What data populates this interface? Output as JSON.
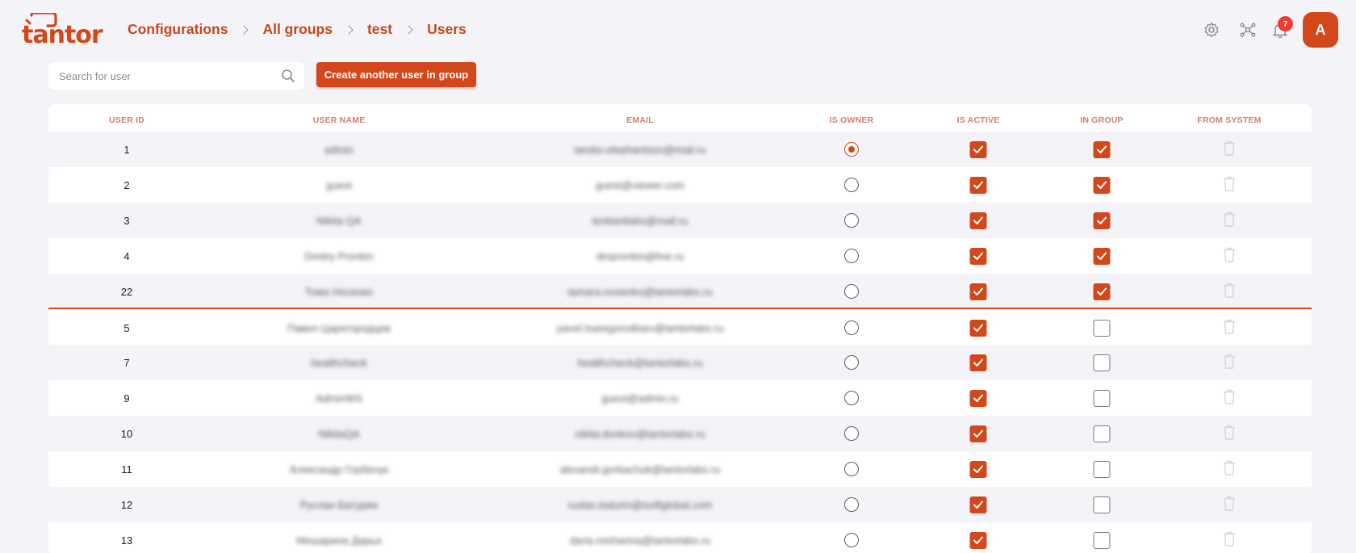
{
  "logo": {
    "text": "tantor"
  },
  "breadcrumb": [
    {
      "label": "Configurations"
    },
    {
      "label": "All groups"
    },
    {
      "label": "test"
    },
    {
      "label": "Users"
    }
  ],
  "header": {
    "notification_count": "7",
    "avatar_initial": "A",
    "icons": [
      "gear-icon",
      "network-icon",
      "bell-icon"
    ]
  },
  "search": {
    "placeholder": "Search for user",
    "value": ""
  },
  "create_button": {
    "label": "Create another user in group"
  },
  "table": {
    "columns": [
      "USER ID",
      "USER NAME",
      "EMAIL",
      "IS OWNER",
      "IS ACTIVE",
      "IN GROUP",
      "FROM SYSTEM"
    ],
    "rows": [
      {
        "id": "1",
        "name": "admin",
        "email": "tandor.elephantson@mail.ru",
        "is_owner": true,
        "is_active": true,
        "in_group": true
      },
      {
        "id": "2",
        "name": "guest",
        "email": "guest@viewer.com",
        "is_owner": false,
        "is_active": true,
        "in_group": true
      },
      {
        "id": "3",
        "name": "Nikita QA",
        "email": "testtantlabs@mail.ru",
        "is_owner": false,
        "is_active": true,
        "in_group": true
      },
      {
        "id": "4",
        "name": "Dmitry Pronkin",
        "email": "dmpronkin@live.ru",
        "is_owner": false,
        "is_active": true,
        "in_group": true
      },
      {
        "id": "22",
        "name": "Тома Носенко",
        "email": "tamara.nosenko@tantorlabs.ru",
        "is_owner": false,
        "is_active": true,
        "in_group": true
      },
      {
        "id": "5",
        "name": "Павел Царегородцев",
        "email": "pavel.tsaregorodtsev@tantorlabs.ru",
        "is_owner": false,
        "is_active": true,
        "in_group": false
      },
      {
        "id": "7",
        "name": "healthcheck",
        "email": "healthcheck@tantorlabs.ru",
        "is_owner": false,
        "is_active": true,
        "in_group": false
      },
      {
        "id": "9",
        "name": "AdminWS",
        "email": "guest@admin.ru",
        "is_owner": false,
        "is_active": true,
        "in_group": false
      },
      {
        "id": "10",
        "name": "NikitaQA",
        "email": "nikita.donkov@tantorlabs.ru",
        "is_owner": false,
        "is_active": true,
        "in_group": false
      },
      {
        "id": "11",
        "name": "Александр Горбачук",
        "email": "alexandr.gorbachuk@tantorlabs.ru",
        "is_owner": false,
        "is_active": true,
        "in_group": false
      },
      {
        "id": "12",
        "name": "Руслан Батурин",
        "email": "ruslan.baturin@isoftglobal.com",
        "is_owner": false,
        "is_active": true,
        "in_group": false
      },
      {
        "id": "13",
        "name": "Мешарина Дарья",
        "email": "daria.misharina@tantorlabs.ru",
        "is_owner": false,
        "is_active": true,
        "in_group": false
      }
    ]
  },
  "colors": {
    "accent": "#d2481a",
    "header_text": "#d0816a",
    "background": "#f3f3f8"
  }
}
